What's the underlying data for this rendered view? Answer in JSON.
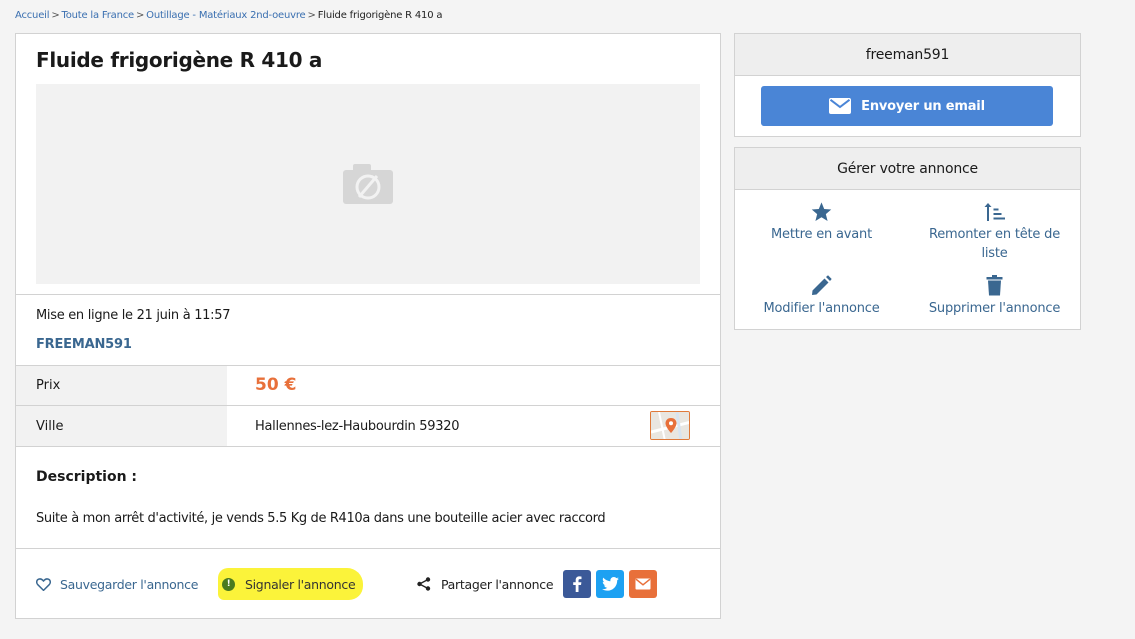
{
  "breadcrumb": {
    "items": [
      "Accueil",
      "Toute la France",
      "Outillage - Matériaux 2nd-oeuvre"
    ],
    "current": "Fluide frigorigène R 410 a",
    "separator": ">"
  },
  "listing": {
    "title": "Fluide frigorigène R 410 a",
    "posted": "Mise en ligne le 21 juin à 11:57",
    "seller": "FREEMAN591",
    "price_label": "Prix",
    "price": "50 €",
    "city_label": "Ville",
    "city": "Hallennes-lez-Haubourdin 59320",
    "description_title": "Description :",
    "description": "Suite à mon arrêt d'activité, je vends 5.5 Kg de R410a dans une bouteille acier avec raccord"
  },
  "actions": {
    "save": "Sauvegarder l'annonce",
    "report": "Signaler l'annonce",
    "share": "Partager l'annonce"
  },
  "contact": {
    "username": "freeman591",
    "email_button": "Envoyer un email"
  },
  "manage": {
    "title": "Gérer votre annonce",
    "feature": "Mettre en avant",
    "bump": "Remonter en tête de liste",
    "edit": "Modifier l'annonce",
    "delete": "Supprimer l'annonce"
  },
  "colors": {
    "accent": "#3a6790",
    "price": "#e8703a",
    "primary_button": "#4a85d6",
    "highlight": "#fbf33a",
    "facebook": "#3b5998",
    "twitter": "#1da1f2",
    "share_email": "#e8703a"
  },
  "icons": {
    "photo": "no-photo-camera-icon",
    "map": "map-pin-icon",
    "save": "heart-icon",
    "report": "exclamation-icon",
    "share": "share-icon",
    "email": "envelope-icon",
    "feature": "star-icon",
    "bump": "sort-up-icon",
    "edit": "pencil-icon",
    "delete": "trash-icon"
  }
}
